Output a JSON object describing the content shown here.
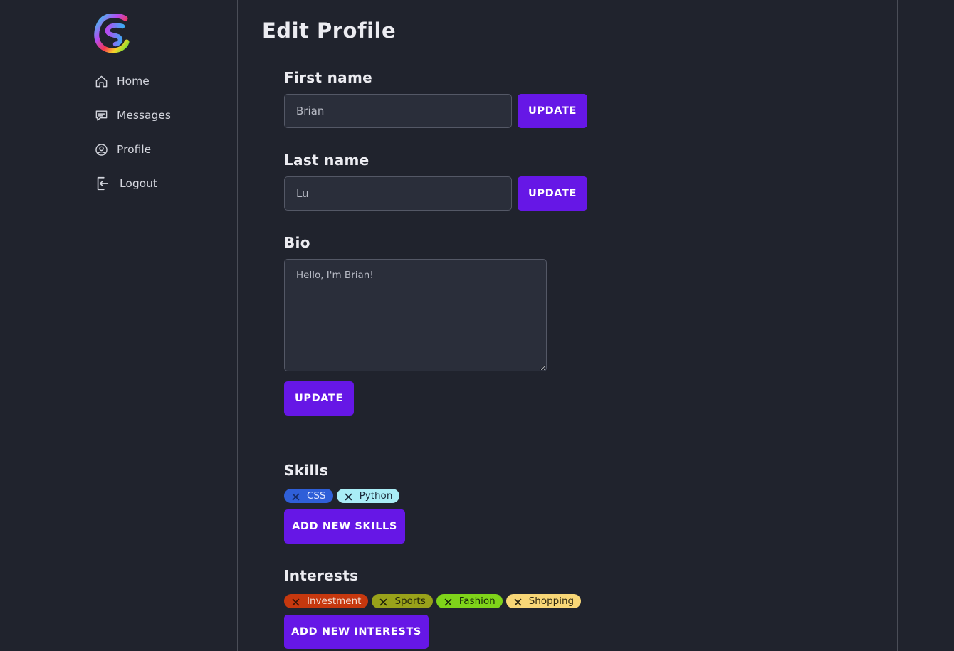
{
  "nav": {
    "items": [
      {
        "label": "Home",
        "icon": "home-icon"
      },
      {
        "label": "Messages",
        "icon": "chat-icon"
      },
      {
        "label": "Profile",
        "icon": "user-circle-icon"
      },
      {
        "label": "Logout",
        "icon": "logout-icon"
      }
    ]
  },
  "page": {
    "title": "Edit Profile"
  },
  "first_name": {
    "label": "First name",
    "value": "Brian",
    "button": "UPDATE"
  },
  "last_name": {
    "label": "Last name",
    "value": "Lu",
    "button": "UPDATE"
  },
  "bio": {
    "label": "Bio",
    "value": "Hello, I'm Brian!",
    "button": "UPDATE"
  },
  "skills": {
    "label": "Skills",
    "tags": [
      {
        "label": "CSS",
        "bg": "#2f5fd8",
        "fg": "#e3e9ff"
      },
      {
        "label": "Python",
        "bg": "#a9edf6",
        "fg": "#1b2b3a"
      }
    ],
    "button": "ADD NEW SKILLS"
  },
  "interests": {
    "label": "Interests",
    "tags": [
      {
        "label": "Investment",
        "bg": "#c6380e",
        "fg": "#f3ddd2"
      },
      {
        "label": "Sports",
        "bg": "#99a21a",
        "fg": "#21230a"
      },
      {
        "label": "Fashion",
        "bg": "#7fd41a",
        "fg": "#182a07"
      },
      {
        "label": "Shopping",
        "bg": "#f8d777",
        "fg": "#2e2710"
      }
    ],
    "button": "ADD NEW INTERESTS"
  },
  "colors": {
    "background": "#20232d",
    "accent": "#6617e6",
    "input_bg": "#2a2e3a",
    "divider": "#4a4d57"
  }
}
